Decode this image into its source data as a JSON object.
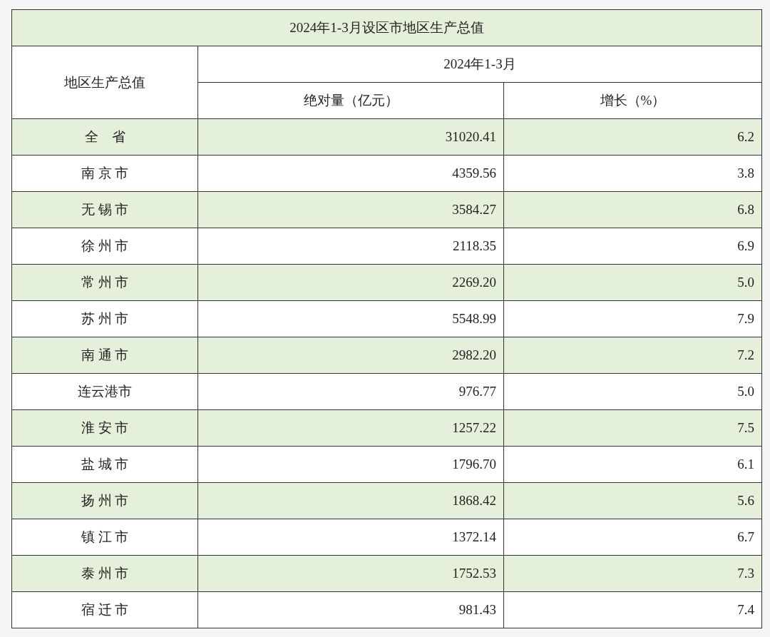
{
  "title": "2024年1-3月设区市地区生产总值",
  "header": {
    "region": "地区生产总值",
    "period": "2024年1-3月",
    "columns": [
      "绝对量（亿元）",
      "增长（%）"
    ]
  },
  "rows": [
    {
      "region": "全　省",
      "value": "31020.41",
      "growth": "6.2",
      "shaded": true
    },
    {
      "region": "南 京 市",
      "value": "4359.56",
      "growth": "3.8",
      "shaded": false
    },
    {
      "region": "无 锡 市",
      "value": "3584.27",
      "growth": "6.8",
      "shaded": true
    },
    {
      "region": "徐 州 市",
      "value": "2118.35",
      "growth": "6.9",
      "shaded": false
    },
    {
      "region": "常 州 市",
      "value": "2269.20",
      "growth": "5.0",
      "shaded": true
    },
    {
      "region": "苏 州 市",
      "value": "5548.99",
      "growth": "7.9",
      "shaded": false
    },
    {
      "region": "南 通 市",
      "value": "2982.20",
      "growth": "7.2",
      "shaded": true
    },
    {
      "region": "连云港市",
      "value": "976.77",
      "growth": "5.0",
      "shaded": false
    },
    {
      "region": "淮 安 市",
      "value": "1257.22",
      "growth": "7.5",
      "shaded": true
    },
    {
      "region": "盐 城 市",
      "value": "1796.70",
      "growth": "6.1",
      "shaded": false
    },
    {
      "region": "扬 州 市",
      "value": "1868.42",
      "growth": "5.6",
      "shaded": true
    },
    {
      "region": "镇 江 市",
      "value": "1372.14",
      "growth": "6.7",
      "shaded": false
    },
    {
      "region": "泰 州 市",
      "value": "1752.53",
      "growth": "7.3",
      "shaded": true
    },
    {
      "region": "宿 迁 市",
      "value": "981.43",
      "growth": "7.4",
      "shaded": false
    }
  ]
}
